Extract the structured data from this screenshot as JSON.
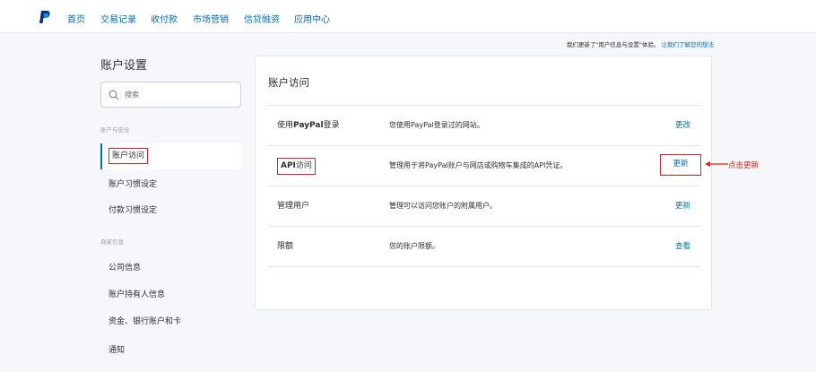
{
  "nav": {
    "items": [
      {
        "label": "首页"
      },
      {
        "label": "交易记录"
      },
      {
        "label": "收付款"
      },
      {
        "label": "市场营销"
      },
      {
        "label": "信贷融资"
      },
      {
        "label": "应用中心"
      }
    ],
    "logo_icon": "paypal-logo-icon",
    "link_color": "#0070ba"
  },
  "notice": {
    "text": "我们更新了\"用户信息与设置\"体验。",
    "link": "让我们了解您的想法"
  },
  "sidebar": {
    "title": "账户设置",
    "search_placeholder": "搜索",
    "sections": [
      {
        "label": "账户与安全",
        "items": [
          "账户访问",
          "账户习惯设定",
          "付款习惯设定"
        ]
      },
      {
        "label": "商家信息",
        "items": [
          "公司信息",
          "账户持有人信息",
          "资金、银行账户和卡",
          "通知"
        ]
      }
    ],
    "active_item": "账户访问"
  },
  "main": {
    "title": "账户访问",
    "rows": [
      {
        "label_prefix": "使用",
        "label_bold": "PayPal",
        "label_suffix": "登录",
        "desc": "您使用PayPal登录过的网站。",
        "action": "更改"
      },
      {
        "label_bold": "API",
        "label_suffix": "访问",
        "desc": "管理用于将PayPal账户与网店或购物车集成的API凭证。",
        "action": "更新"
      },
      {
        "label": "管理用户",
        "desc": "管理可以访问您账户的附属用户。",
        "action": "更新"
      },
      {
        "label": "限额",
        "desc": "您的账户限额。",
        "action": "查看"
      }
    ]
  },
  "annotation": {
    "callout": "点击更新",
    "color": "#e02020"
  }
}
